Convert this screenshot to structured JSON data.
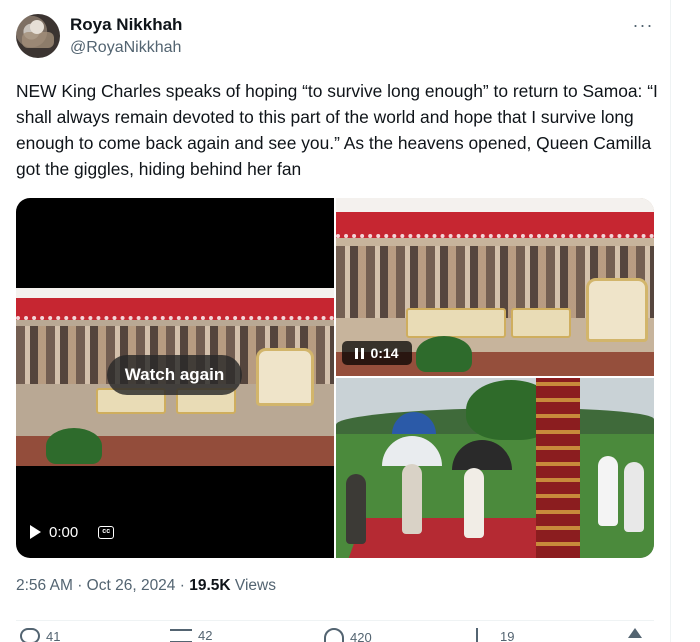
{
  "author": {
    "name": "Roya Nikkhah",
    "handle": "@RoyaNikkhah"
  },
  "more_label": "···",
  "tweet": {
    "text": "NEW King Charles speaks of hoping “to survive long enough” to return to Samoa: “I shall always remain devoted to this part of the world and hope that I survive long enough to come back again and see you.” As the heavens opened, Queen Camilla got the giggles, hiding behind her fan"
  },
  "media": {
    "video": {
      "overlay_label": "Watch again",
      "time": "0:00",
      "cc_label": "cc"
    },
    "clip": {
      "time": "0:14"
    }
  },
  "meta": {
    "time": "2:56 AM",
    "separator": "·",
    "date": "Oct 26, 2024",
    "views_count": "19.5K",
    "views_label": "Views"
  },
  "actions": {
    "replies": "41",
    "reposts": "42",
    "likes": "420",
    "bookmarks": "19"
  },
  "colors": {
    "text": "#0f1419",
    "secondary": "#536471",
    "divider": "#eff3f4"
  }
}
